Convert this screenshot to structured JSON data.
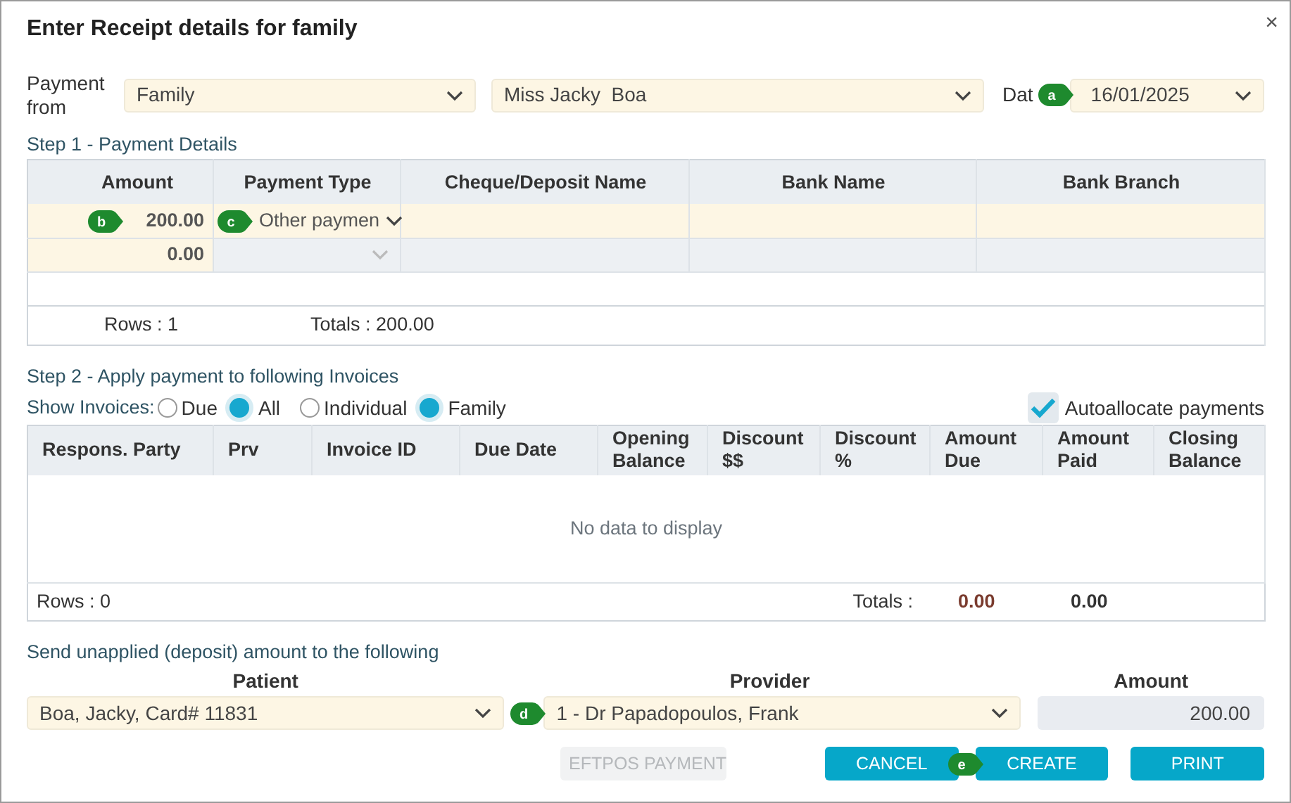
{
  "dialog": {
    "title": "Enter Receipt details for family",
    "close": "×"
  },
  "payment_from": {
    "label": "Payment from",
    "type": "Family",
    "payer": "Miss Jacky  Boa",
    "date_label": "Dat",
    "date_callout": "a",
    "date": "16/01/2025"
  },
  "step1": {
    "title": "Step 1 - Payment Details",
    "columns": [
      "Amount",
      "Payment Type",
      "Cheque/Deposit Name",
      "Bank Name",
      "Bank Branch"
    ],
    "rows": [
      {
        "amount": "200.00",
        "amount_callout": "b",
        "payment_type": "Other paymen",
        "type_callout": "c",
        "selected": true
      },
      {
        "amount": "0.00",
        "selected": false
      }
    ],
    "rows_count": "Rows : 1",
    "totals": "Totals : 200.00"
  },
  "step2": {
    "title": "Step 2 - Apply payment to following Invoices",
    "show_label": "Show Invoices:",
    "radio_groups": [
      [
        {
          "label": "Due",
          "selected": false
        },
        {
          "label": "All",
          "selected": true
        }
      ],
      [
        {
          "label": "Individual",
          "selected": false
        },
        {
          "label": "Family",
          "selected": true
        }
      ]
    ],
    "autoallocate": {
      "label": "Autoallocate payments",
      "checked": true
    },
    "columns": [
      "Respons. Party",
      "Prv",
      "Invoice ID",
      "Due Date",
      "Opening Balance",
      "Discount $$",
      "Discount %",
      "Amount Due",
      "Amount Paid",
      "Closing Balance"
    ],
    "empty": "No data to display",
    "rows_count": "Rows : 0",
    "totals_label": "Totals :",
    "amount_due_total": "0.00",
    "amount_paid_total": "0.00"
  },
  "deposit": {
    "title": "Send unapplied (deposit) amount to the following",
    "patient_label": "Patient",
    "patient": "Boa, Jacky, Card# 11831",
    "provider_label": "Provider",
    "provider_callout": "d",
    "provider": "1 - Dr Papadopoulos, Frank",
    "amount_label": "Amount",
    "amount": "200.00"
  },
  "buttons": [
    {
      "label": "EFTPOS PAYMENT",
      "disabled": true
    },
    {
      "label": "CANCEL",
      "disabled": false
    },
    {
      "label": "CREATE",
      "disabled": false,
      "callout": "e"
    },
    {
      "label": "PRINT",
      "disabled": false
    }
  ]
}
